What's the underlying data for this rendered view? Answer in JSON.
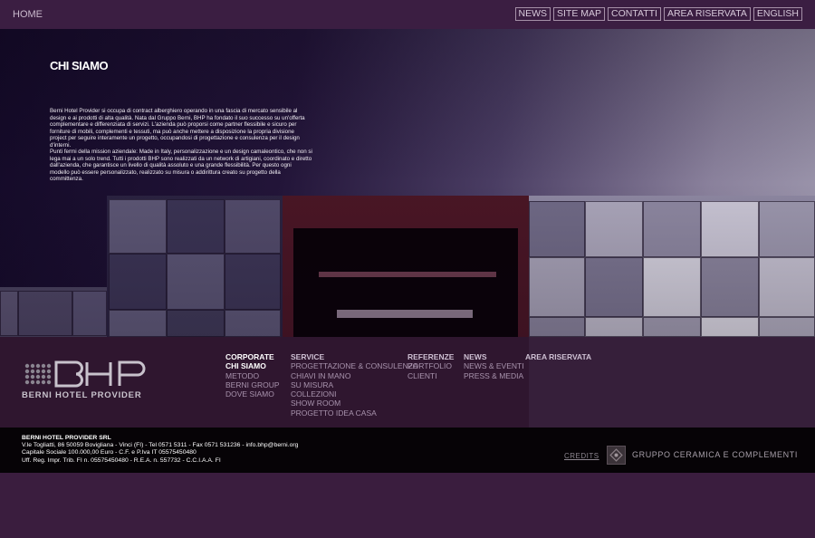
{
  "topbar": {
    "home_label": "HOME",
    "nav": [
      "NEWS",
      "SITE MAP",
      "CONTATTI",
      "AREA RISERVATA",
      "ENGLISH"
    ]
  },
  "hero": {
    "title": "CHI SIAMO",
    "paragraph1": "Berni Hotel Provider si occupa di contract alberghiero operando in una fascia di mercato sensibile al design e ai prodotti di alta qualità. Nata dal Gruppo Berni, BHP ha fondato il suo successo su un'offerta complementare e differenziata di servizi. L'azienda può proporsi come partner flessibile e sicuro per forniture di mobili, complementi e tessuti, ma può anche mettere a disposizione la propria divisione project per seguire interamente un progetto, occupandosi di progettazione e consulenza per il design d'interni.",
    "paragraph2": "Punti fermi della mission aziendale: Made in Italy, personalizzazione e un design camaleontico, che non si lega mai a un solo trend. Tutti i prodotti BHP sono realizzati da un network di artigiani, coordinato e diretto dall'azienda, che garantisce un livello di qualità assoluto e una grande flessibilità. Per questo ogni modello può essere personalizzato, realizzato su misura o addirittura creato su progetto della committenza."
  },
  "logo": {
    "letters": "BHP",
    "text": "BERNI HOTEL PROVIDER"
  },
  "footer_nav": {
    "corporate": {
      "head": "CORPORATE",
      "items": [
        "CHI SIAMO",
        "METODO",
        "BERNI GROUP",
        "DOVE SIAMO"
      ]
    },
    "service": {
      "head": "SERVICE",
      "items": [
        "PROGETTAZIONE & CONSULENZA",
        "CHIAVI IN MANO",
        "SU MISURA",
        "COLLEZIONI",
        "SHOW ROOM",
        "PROGETTO IDEA CASA"
      ]
    },
    "referenze": {
      "head": "REFERENZE",
      "items": [
        "PORTFOLIO",
        "CLIENTI"
      ]
    },
    "news": {
      "head": "NEWS",
      "items": [
        "NEWS & EVENTI",
        "PRESS & MEDIA"
      ]
    },
    "area": {
      "head": "AREA RISERVATA"
    }
  },
  "company": {
    "name": "BERNI HOTEL PROVIDER SRL",
    "line1": "V.le Togliatti, 86 50059 Bovigliana - Vinci (FI) - Tel 0571 5311 - Fax 0571 531236 - info.bhp@berni.org",
    "line2": "Capitale Sociale 100.000,00 Euro - C.F. e P.Iva IT 05575450480",
    "line3": "Uff. Reg. Impr. Trib. FI n. 05575450480 - R.E.A. n. 557732 - C.C.I.A.A. FI"
  },
  "credits_label": "CREDITS",
  "group_label": "GRUPPO CERAMICA E COMPLEMENTI"
}
